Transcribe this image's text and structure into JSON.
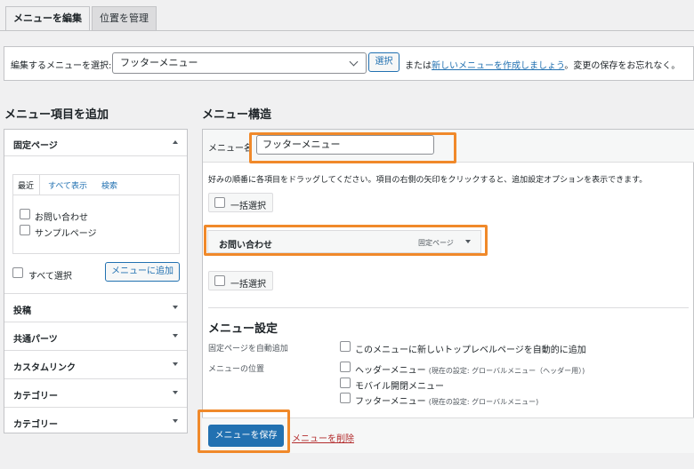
{
  "tabs": [
    "メニューを編集",
    "位置を管理"
  ],
  "select_bar": {
    "label": "編集するメニューを選択:",
    "selected": "フッターメニュー",
    "select_button": "選択",
    "or_text": "または",
    "create_link": "新しいメニューを作成しましょう",
    "tail": "。変更の保存をお忘れなく。"
  },
  "left": {
    "heading": "メニュー項目を追加",
    "pages_section": "固定ページ",
    "inner_tabs": [
      "最近",
      "すべて表示",
      "検索"
    ],
    "pages": [
      "お問い合わせ",
      "サンプルページ"
    ],
    "select_all": "すべて選択",
    "add_button": "メニューに追加",
    "sections": [
      "投稿",
      "共通パーツ",
      "カスタムリンク",
      "カテゴリー",
      "カテゴリー"
    ]
  },
  "right": {
    "heading": "メニュー構造",
    "name_label": "メニュー名",
    "name_value": "フッターメニュー",
    "instructions": "好みの順番に各項目をドラッグしてください。項目の右側の矢印をクリックすると、追加設定オプションを表示できます。",
    "bulk_select": "一括選択",
    "item": {
      "title": "お問い合わせ",
      "type": "固定ページ"
    },
    "settings_heading": "メニュー設定",
    "auto_add_label": "固定ページを自動追加",
    "auto_add_option": "このメニューに新しいトップレベルページを自動的に追加",
    "location_label": "メニューの位置",
    "locations": [
      {
        "name": "ヘッダーメニュー",
        "note": "(現在の設定: グローバルメニュー（ヘッダー用）)"
      },
      {
        "name": "モバイル開閉メニュー",
        "note": ""
      },
      {
        "name": "フッターメニュー",
        "note": "(現在の設定: グローバルメニュー)"
      }
    ],
    "save_button": "メニューを保存",
    "delete_link": "メニューを削除"
  },
  "colors": {
    "accent": "#2271b1",
    "highlight": "#f0892a",
    "delete": "#b32d2e"
  }
}
